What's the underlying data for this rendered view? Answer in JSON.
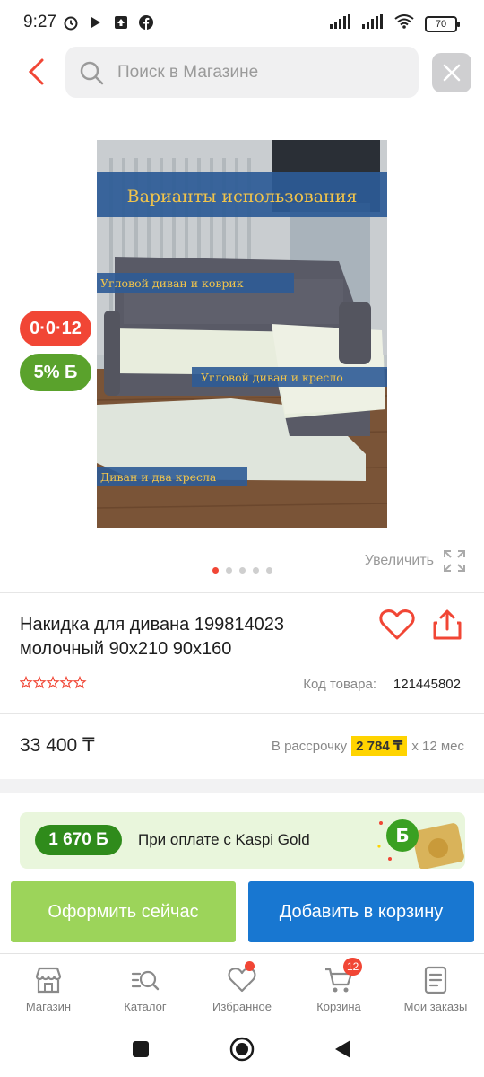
{
  "status_bar": {
    "time": "9:27",
    "battery": "70"
  },
  "search": {
    "placeholder": "Поиск в Магазине"
  },
  "product": {
    "image_texts": {
      "heading": "Варианты использования",
      "label1": "Угловой диван и коврик",
      "label2": "Угловой диван и кресло",
      "label3": "Диван и два кресла"
    },
    "badge_installment": "0·0·12",
    "badge_bonus": "5% Б",
    "zoom_label": "Увеличить",
    "gallery_count": 5,
    "gallery_active": 0,
    "title": "Накидка для дивана 199814023 молочный 90x210 90x160",
    "rating": 0,
    "code_label": "Код товара:",
    "code_value": "121445802",
    "price": "33 400 ₸",
    "installment_prefix": "В рассрочку",
    "installment_amount": "2 784 ₸",
    "installment_suffix": "x 12 мес"
  },
  "kaspi_gold": {
    "bonus": "1 670 Б",
    "text": "При оплате с Kaspi Gold"
  },
  "actions": {
    "buy_now": "Оформить сейчас",
    "add_to_cart": "Добавить в корзину"
  },
  "tabs": [
    {
      "label": "Магазин",
      "icon": "shop-icon"
    },
    {
      "label": "Каталог",
      "icon": "catalog-search-icon"
    },
    {
      "label": "Избранное",
      "icon": "heart-icon"
    },
    {
      "label": "Корзина",
      "icon": "cart-icon",
      "badge": "12"
    },
    {
      "label": "Мои заказы",
      "icon": "orders-icon"
    }
  ],
  "colors": {
    "accent_red": "#f14635",
    "kaspi_green": "#2f8b1b",
    "buy_green": "#9cd45a",
    "cart_blue": "#1877d1",
    "installment_yellow": "#ffd400"
  }
}
